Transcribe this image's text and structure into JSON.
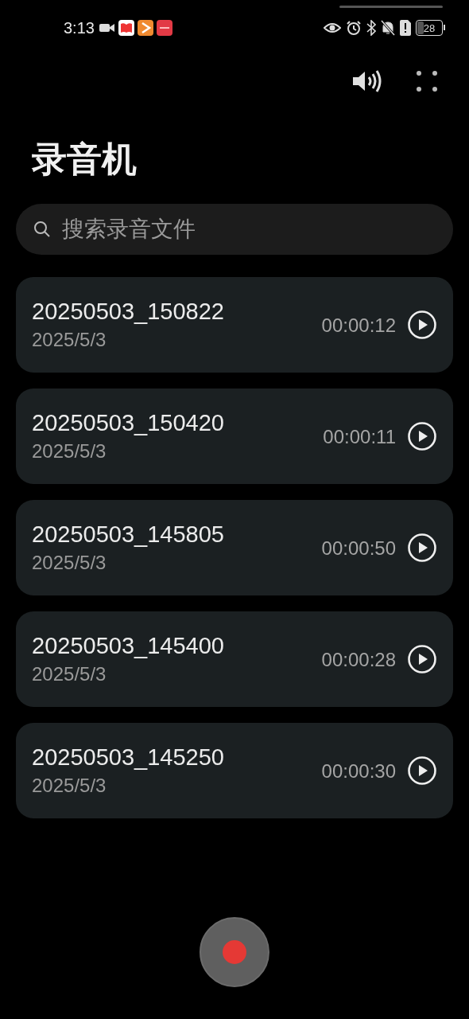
{
  "status_bar": {
    "time": "3:13",
    "battery": "28"
  },
  "title": "录音机",
  "search": {
    "placeholder": "搜索录音文件"
  },
  "recordings": [
    {
      "name": "20250503_150822",
      "date": "2025/5/3",
      "duration": "00:00:12"
    },
    {
      "name": "20250503_150420",
      "date": "2025/5/3",
      "duration": "00:00:11"
    },
    {
      "name": "20250503_145805",
      "date": "2025/5/3",
      "duration": "00:00:50"
    },
    {
      "name": "20250503_145400",
      "date": "2025/5/3",
      "duration": "00:00:28"
    },
    {
      "name": "20250503_145250",
      "date": "2025/5/3",
      "duration": "00:00:30"
    }
  ]
}
